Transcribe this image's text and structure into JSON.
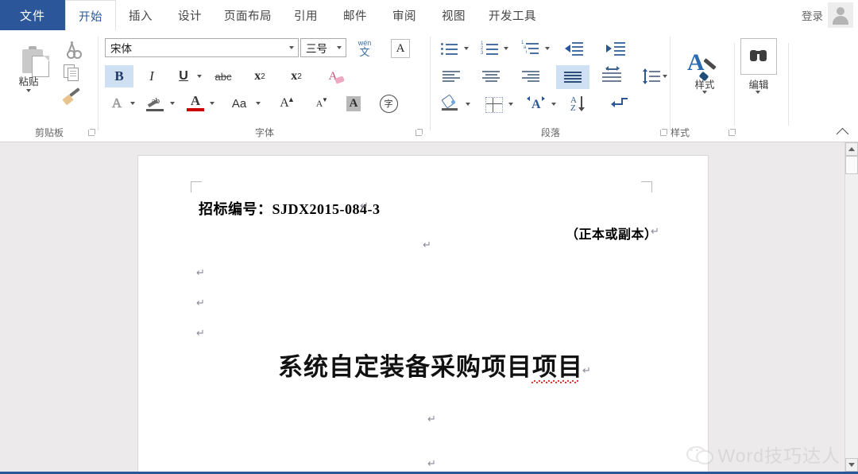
{
  "window": {
    "tabs": [
      {
        "id": "file",
        "label": "文件"
      },
      {
        "id": "home",
        "label": "开始"
      },
      {
        "id": "insert",
        "label": "插入"
      },
      {
        "id": "design",
        "label": "设计"
      },
      {
        "id": "layout",
        "label": "页面布局"
      },
      {
        "id": "references",
        "label": "引用"
      },
      {
        "id": "mailings",
        "label": "邮件"
      },
      {
        "id": "review",
        "label": "审阅"
      },
      {
        "id": "view",
        "label": "视图"
      },
      {
        "id": "developer",
        "label": "开发工具"
      }
    ],
    "active_tab": "开始",
    "signin_label": "登录",
    "accent_color": "#2b579a"
  },
  "ribbon": {
    "groups": [
      {
        "id": "clipboard",
        "label": "剪贴板"
      },
      {
        "id": "font",
        "label": "字体"
      },
      {
        "id": "paragraph",
        "label": "段落"
      },
      {
        "id": "styles",
        "label": "样式"
      }
    ],
    "clipboard": {
      "paste_label": "粘贴",
      "cut_name": "剪切",
      "copy_name": "复制",
      "format_painter_name": "格式刷"
    },
    "font": {
      "font_name_value": "宋体",
      "font_size_value": "三号",
      "bold_label": "B",
      "italic_label": "I",
      "underline_label": "U",
      "strikethrough_label": "abc",
      "subscript_label": "x",
      "subscript_sub": "2",
      "superscript_label": "x",
      "superscript_sup": "2",
      "clear_format_label": "A",
      "text_effects_label": "A",
      "highlight_label": "ab",
      "font_color_label": "A",
      "change_case_label": "Aa",
      "grow_font_label": "A",
      "shrink_font_label": "A",
      "char_shading_label": "A",
      "enclose_char_label": "字",
      "phonetic_guide_top": "wén",
      "phonetic_guide_bottom": "文",
      "border_label": "A"
    },
    "paragraph": {
      "bullets_name": "项目符号",
      "numbering_name": "编号",
      "multilevel_name": "多级列表",
      "decrease_indent_name": "减少缩进量",
      "increase_indent_name": "增加缩进量",
      "align_left_name": "左对齐",
      "align_center_name": "居中",
      "align_right_name": "右对齐",
      "justify_name": "两端对齐",
      "distribute_name": "分散对齐",
      "line_spacing_name": "行和段落间距",
      "shading_name": "底纹",
      "borders_name": "边框",
      "asian_layout_name": "中文版式",
      "sort_label_a": "A",
      "sort_label_z": "Z",
      "show_marks_name": "显示编辑标记"
    },
    "styles": {
      "styles_label": "样式",
      "editing_label": "编辑"
    }
  },
  "document": {
    "bid_number": "招标编号：SJDX2015-084-3",
    "copy_note": "（正本或副本）",
    "title": "系统自定装备采购项目项目",
    "title_misspelled_tail": "项目",
    "pilcrow": "↵",
    "empty_paragraphs": 6
  },
  "watermark": {
    "text": "Word技巧达人"
  },
  "scrollbar": {
    "up_name": "向上滚动",
    "down_name": "向下滚动",
    "thumb_name": "滚动滑块"
  }
}
